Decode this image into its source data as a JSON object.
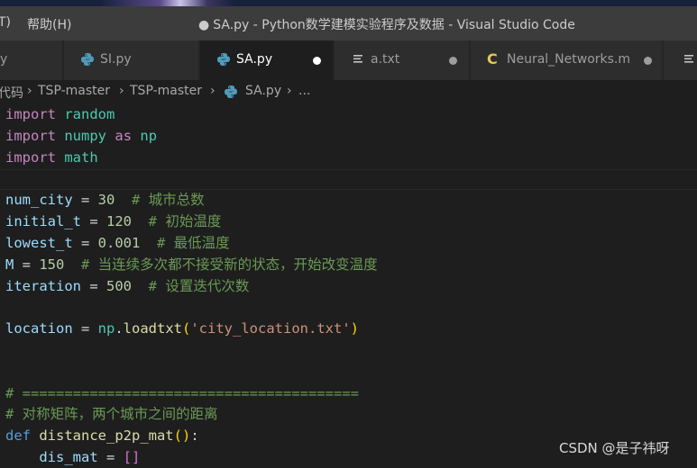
{
  "titlebar": {
    "menu": [
      {
        "label": "T)"
      },
      {
        "label": "帮助(H)"
      }
    ],
    "modified_dot": "●",
    "title": "SA.py - Python数学建模实验程序及数据 - Visual Studio Code"
  },
  "tabs": [
    {
      "label": "y",
      "icon": "python-icon"
    },
    {
      "label": "SI.py",
      "icon": "python-icon"
    },
    {
      "label": "SA.py",
      "icon": "python-icon",
      "active": true,
      "modified": true
    },
    {
      "label": "a.txt",
      "icon": "text-file-icon",
      "modified": true
    },
    {
      "label": "Neural_Networks.m",
      "icon": "c-file-icon",
      "modified": true
    },
    {
      "label": "",
      "icon": "text-file-icon"
    }
  ],
  "breadcrumb": {
    "items": [
      "代码",
      "TSP-master",
      "TSP-master",
      "SA.py",
      "..."
    ],
    "separator": "›"
  },
  "code": {
    "l1": {
      "kw": "import",
      "name": "random"
    },
    "l2": {
      "kw": "import",
      "name": "numpy",
      "as": "as",
      "alias": "np"
    },
    "l3": {
      "kw": "import",
      "name": "math"
    },
    "l5": {
      "var": "num_city",
      "op": " = ",
      "num": "30",
      "cmt": "  # 城市总数"
    },
    "l6": {
      "var": "initial_t",
      "op": " = ",
      "num": "120",
      "cmt": "  # 初始温度"
    },
    "l7": {
      "var": "lowest_t",
      "op": " = ",
      "num": "0.001",
      "cmt": "  # 最低温度"
    },
    "l8": {
      "var": "M",
      "op": " = ",
      "num": "150",
      "cmt": "  # 当连续多次都不接受新的状态，开始改变温度"
    },
    "l9": {
      "var": "iteration",
      "op": " = ",
      "num": "500",
      "cmt": "  # 设置迭代次数"
    },
    "l11": {
      "var": "location",
      "op": " = ",
      "obj": "np",
      "dot": ".",
      "fn": "loadtxt",
      "lp": "(",
      "str": "'city_location.txt'",
      "rp": ")"
    },
    "l14": {
      "cmt": "# ========================================"
    },
    "l15": {
      "cmt": "# 对称矩阵，两个城市之间的距离"
    },
    "l16": {
      "kw": "def",
      "fn": " distance_p2p_mat",
      "paren": "()",
      "colon": ":"
    },
    "l17": {
      "indent": "    ",
      "var": "dis_mat",
      "op": " = ",
      "br": "[]"
    }
  },
  "watermark": "CSDN @是子祎呀",
  "colors": {
    "keyword": "#c586c0",
    "def": "#569cd6",
    "module": "#4ec9b0",
    "variable": "#9cdcfe",
    "number": "#b5cea8",
    "comment": "#6a9955",
    "function": "#dcdcaa",
    "string": "#ce9178",
    "python_icon": "#519aba",
    "c_icon": "#e8c84a"
  }
}
